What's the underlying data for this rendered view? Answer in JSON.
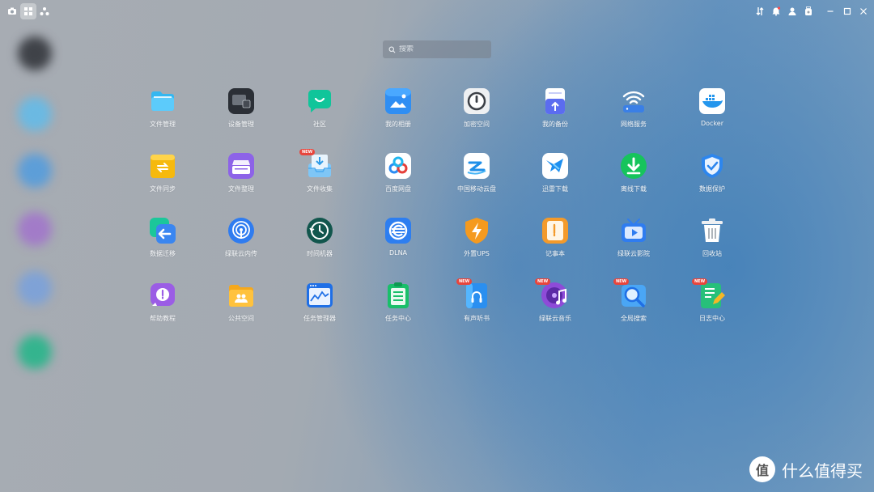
{
  "search": {
    "placeholder": "搜索"
  },
  "apps": [
    {
      "label": "文件管理"
    },
    {
      "label": "设备管理"
    },
    {
      "label": "社区"
    },
    {
      "label": "我的相册"
    },
    {
      "label": "加密空间"
    },
    {
      "label": "我的备份"
    },
    {
      "label": "网络服务"
    },
    {
      "label": "Docker"
    },
    {
      "label": "文件同步"
    },
    {
      "label": "文件整理"
    },
    {
      "label": "文件收集",
      "badge": "NEW"
    },
    {
      "label": "百度网盘"
    },
    {
      "label": "中国移动云盘"
    },
    {
      "label": "迅雷下载"
    },
    {
      "label": "离线下载"
    },
    {
      "label": "数据保护"
    },
    {
      "label": "数据迁移"
    },
    {
      "label": "绿联云内传"
    },
    {
      "label": "时间机器"
    },
    {
      "label": "DLNA"
    },
    {
      "label": "外置UPS"
    },
    {
      "label": "记事本"
    },
    {
      "label": "绿联云影院"
    },
    {
      "label": "回收站"
    },
    {
      "label": "帮助教程"
    },
    {
      "label": "公共空间"
    },
    {
      "label": "任务管理器"
    },
    {
      "label": "任务中心"
    },
    {
      "label": "有声听书",
      "badge": "NEW"
    },
    {
      "label": "绿联云音乐",
      "badge": "NEW"
    },
    {
      "label": "全局搜索",
      "badge": "NEW"
    },
    {
      "label": "日志中心",
      "badge": "NEW"
    }
  ],
  "watermark": {
    "text": "什么值得买",
    "logo_glyph": "值"
  }
}
